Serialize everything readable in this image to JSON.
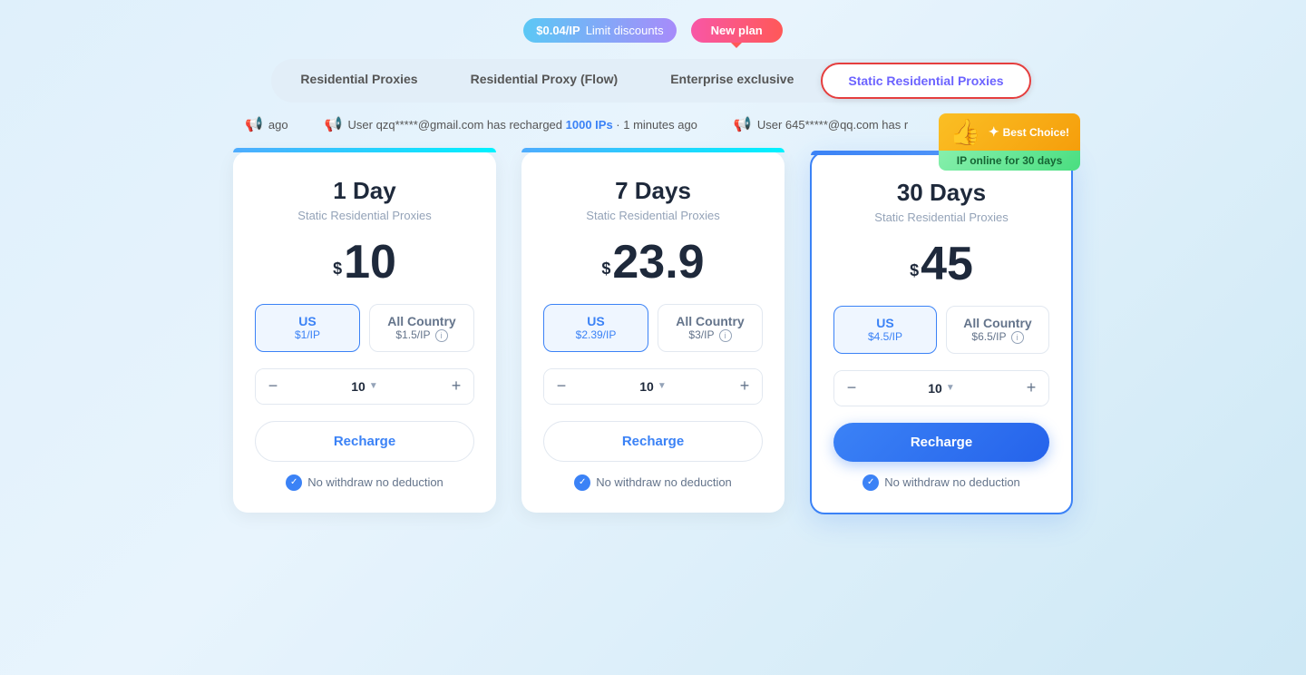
{
  "promo": {
    "discount_badge": "$0.04/IP",
    "discount_label": "Limit discounts",
    "newplan_label": "New plan"
  },
  "tabs": [
    {
      "id": "residential",
      "label": "Residential Proxies",
      "active": false
    },
    {
      "id": "residential-flow",
      "label": "Residential Proxy (Flow)",
      "active": false
    },
    {
      "id": "enterprise",
      "label": "Enterprise exclusive",
      "active": false
    },
    {
      "id": "static-residential",
      "label": "Static Residential Proxies",
      "active": true
    }
  ],
  "activity": [
    {
      "text": "ago",
      "highlight": ""
    },
    {
      "text": "User qzq*****@gmail.com has recharged",
      "highlight": "1000 IPs",
      "suffix": "· 1 minutes ago"
    },
    {
      "text": "User 645*****@qq.com has r",
      "highlight": ""
    }
  ],
  "cards": [
    {
      "id": "1day",
      "title": "1 Day",
      "subtitle": "Static Residential Proxies",
      "price": "10",
      "featured": false,
      "best_choice": false,
      "us_label": "US",
      "us_price": "$1/IP",
      "all_country_label": "All Country",
      "all_country_price": "$1.5/IP",
      "quantity": "10",
      "recharge_label": "Recharge",
      "no_deduction_label": "No withdraw no deduction"
    },
    {
      "id": "7days",
      "title": "7 Days",
      "subtitle": "Static Residential Proxies",
      "price": "23.9",
      "featured": false,
      "best_choice": false,
      "us_label": "US",
      "us_price": "$2.39/IP",
      "all_country_label": "All Country",
      "all_country_price": "$3/IP",
      "quantity": "10",
      "recharge_label": "Recharge",
      "no_deduction_label": "No withdraw no deduction"
    },
    {
      "id": "30days",
      "title": "30 Days",
      "subtitle": "Static Residential Proxies",
      "price": "45",
      "featured": true,
      "best_choice": true,
      "best_choice_label": "Best Choice!",
      "best_choice_sub": "IP online for 30 days",
      "us_label": "US",
      "us_price": "$4.5/IP",
      "all_country_label": "All Country",
      "all_country_price": "$6.5/IP",
      "quantity": "10",
      "recharge_label": "Recharge",
      "no_deduction_label": "No withdraw no deduction"
    }
  ]
}
